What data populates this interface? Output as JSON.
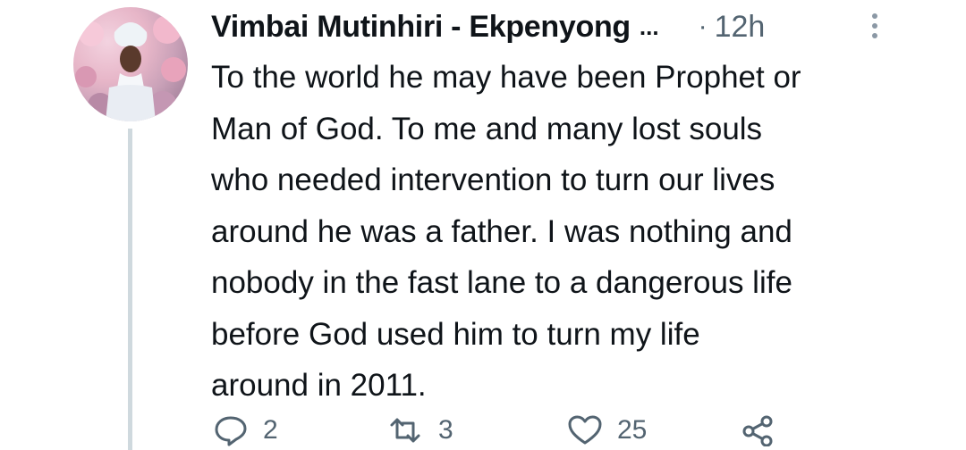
{
  "tweet": {
    "author_name": "Vimbai Mutinhiri - Ekpenyong",
    "name_truncation": "...",
    "separator": "·",
    "timestamp": "12h",
    "body_lines": [
      "To the world he may have been Prophet or",
      "Man of God. To me and many lost souls",
      "who needed intervention to turn our lives",
      "around he was a father. I was nothing and",
      "nobody in the fast lane to a dangerous life",
      "before God used him to turn my life",
      "around in 2011."
    ],
    "actions": {
      "reply": {
        "icon": "reply-icon",
        "count": "2"
      },
      "retweet": {
        "icon": "retweet-icon",
        "count": "3"
      },
      "like": {
        "icon": "heart-icon",
        "count": "25"
      },
      "share": {
        "icon": "share-icon"
      }
    }
  },
  "colors": {
    "text_primary": "#0f1419",
    "text_secondary": "#536471",
    "thread_line": "#cfd9de"
  }
}
